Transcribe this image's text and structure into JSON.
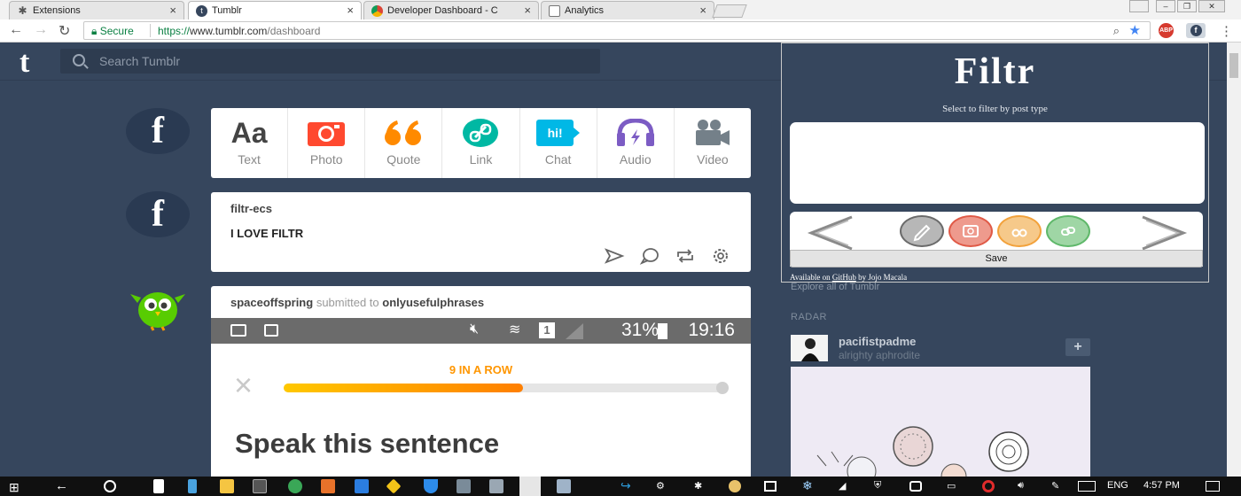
{
  "browser": {
    "tabs": [
      {
        "title": "Extensions",
        "icon": "puzzle-icon",
        "active": false
      },
      {
        "title": "Tumblr",
        "icon": "tumblr-icon",
        "active": true
      },
      {
        "title": "Developer Dashboard - C",
        "icon": "chrome-webstore-icon",
        "active": false
      },
      {
        "title": "Analytics",
        "icon": "page-icon",
        "active": false
      }
    ],
    "close_glyph": "×",
    "secure_label": "Secure",
    "url_scheme": "https://",
    "url_host": "www.tumblr.com",
    "url_path": "/dashboard",
    "ext_abp": "ABP",
    "menu_glyph": "⋮"
  },
  "tumblr": {
    "logo": "t",
    "search_placeholder": "Search Tumblr",
    "avatar_letter": "f",
    "post_types": [
      {
        "label": "Text",
        "icon": "text-icon",
        "color": "#444444"
      },
      {
        "label": "Photo",
        "icon": "camera-icon",
        "color": "#ff492f"
      },
      {
        "label": "Quote",
        "icon": "quote-icon",
        "color": "#ff8a00"
      },
      {
        "label": "Link",
        "icon": "link-icon",
        "color": "#00b8a3"
      },
      {
        "label": "Chat",
        "icon": "chat-icon",
        "color": "#00b8e6"
      },
      {
        "label": "Audio",
        "icon": "headphones-icon",
        "color": "#7c5cc4"
      },
      {
        "label": "Video",
        "icon": "video-camera-icon",
        "color": "#748089"
      }
    ],
    "text_glyph": "Aa",
    "chat_glyph": "hi!"
  },
  "posts": [
    {
      "user": "filtr-ecs",
      "body": "I LOVE FILTR"
    },
    {
      "user": "spaceoffspring",
      "submitted": "submitted to",
      "target": "onlyusefulphrases",
      "phone_status": {
        "battery": "31%",
        "time": "19:16",
        "sim": "1"
      },
      "streak": "9 IN A ROW",
      "streak_progress_pct": 54,
      "close_glyph": "×",
      "prompt": "Speak this sentence"
    }
  ],
  "sidebar": {
    "explore": "Explore all of Tumblr",
    "radar_label": "RADAR",
    "radar_user": "pacifistpadme",
    "radar_sub": "alrighty aphrodite",
    "follow_glyph": "+"
  },
  "filtr": {
    "title": "Filtr",
    "subtitle": "Select to filter by post type",
    "save_label": "Save",
    "available_prefix": "Available on",
    "github": "GitHub",
    "author": "by Jojo Macala",
    "circle_colors": [
      "#6b6b6b",
      "#e05a47",
      "#f2a23c",
      "#5fb86a"
    ],
    "circle_icons": [
      "pencil-icon",
      "camera-icon",
      "quote-icon",
      "link-icon"
    ]
  },
  "taskbar": {
    "lang": "ENG",
    "time": "4:57 PM"
  }
}
